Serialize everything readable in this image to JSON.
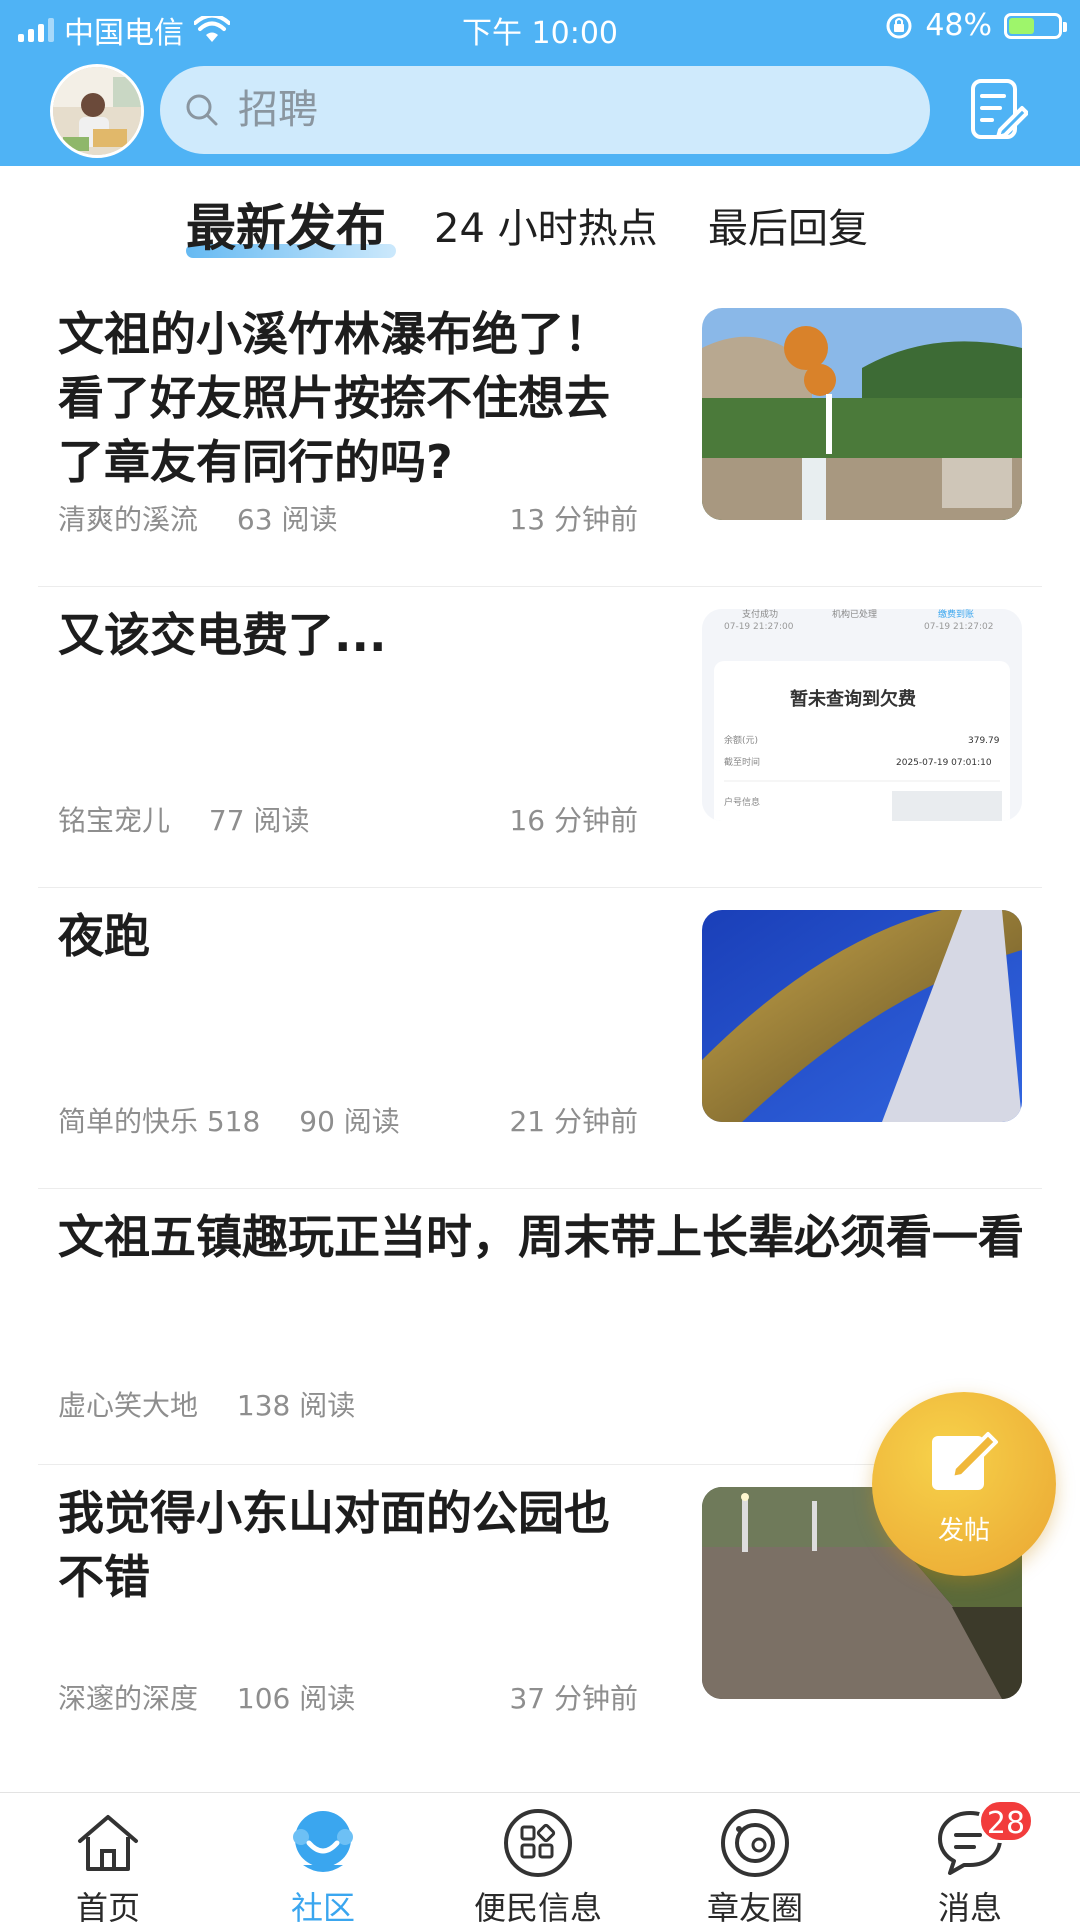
{
  "status_bar": {
    "carrier": "中国电信",
    "time": "下午 10:00",
    "battery_percent": "48%"
  },
  "header": {
    "search_placeholder": "招聘"
  },
  "tabs": [
    {
      "label": "最新发布",
      "active": true
    },
    {
      "label": "24 小时热点",
      "active": false
    },
    {
      "label": "最后回复",
      "active": false
    }
  ],
  "posts": [
    {
      "title": "文祖的小溪竹林瀑布绝了！看了好友照片按捺不住想去了章友有同行的吗?",
      "author": "清爽的溪流",
      "reads": "63 阅读",
      "time": "13 分钟前"
    },
    {
      "title": "又该交电费了...",
      "author": "铭宝宠儿",
      "reads": "77 阅读",
      "time": "16 分钟前"
    },
    {
      "title": "夜跑",
      "author": "简单的快乐 518",
      "reads": "90 阅读",
      "time": "21 分钟前"
    },
    {
      "title": "文祖五镇趣玩正当时，周末带上长辈必须看一看",
      "author": "虚心笑大地",
      "reads": "138 阅读",
      "time": ""
    },
    {
      "title": "我觉得小东山对面的公园也不错",
      "author": "深邃的深度",
      "reads": "106 阅读",
      "time": "37 分钟前"
    }
  ],
  "bill_image_text": {
    "heading": "暂未查询到欠费",
    "balance_label": "余额(元)",
    "balance_value": "379.79",
    "date_label": "截至时间",
    "date_value": "2025-07-19 07:01:10",
    "account_label": "户号信息",
    "top_left_time": "07-19 21:27:00",
    "top_right_time": "07-19 21:27:02",
    "top_left": "支付成功",
    "top_mid": "机构已处理",
    "top_right": "缴费到账"
  },
  "fab": {
    "label": "发帖"
  },
  "bottom_nav": [
    {
      "label": "首页",
      "icon": "home-icon",
      "active": false
    },
    {
      "label": "社区",
      "icon": "community-icon",
      "active": true
    },
    {
      "label": "便民信息",
      "icon": "grid-icon",
      "active": false
    },
    {
      "label": "章友圈",
      "icon": "planet-icon",
      "active": false
    },
    {
      "label": "消息",
      "icon": "message-icon",
      "active": false,
      "badge": "28"
    }
  ],
  "colors": {
    "header_bg": "#4fb3f5",
    "accent": "#3aa6ef",
    "fab": "#f0b83a",
    "badge": "#f23c3c"
  }
}
